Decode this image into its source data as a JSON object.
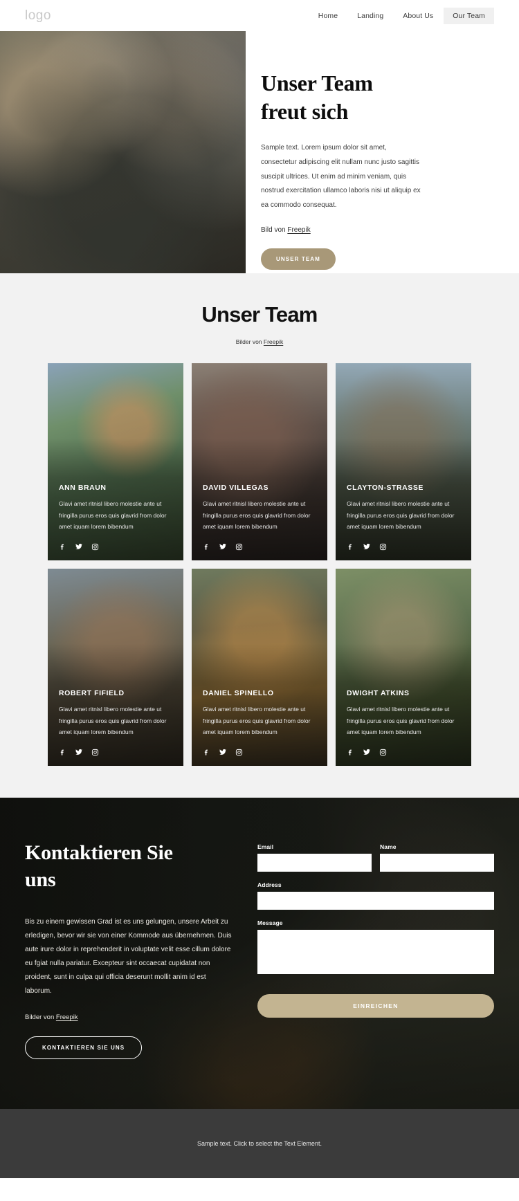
{
  "header": {
    "logo": "logo",
    "nav": [
      {
        "label": "Home",
        "active": false
      },
      {
        "label": "Landing",
        "active": false
      },
      {
        "label": "About Us",
        "active": false
      },
      {
        "label": "Our Team",
        "active": true
      }
    ]
  },
  "hero": {
    "title_line1": "Unser Team",
    "title_line2": "freut sich",
    "paragraph": "Sample text. Lorem ipsum dolor sit amet, consectetur adipiscing elit nullam nunc justo sagittis suscipit ultrices. Ut enim ad minim veniam, quis nostrud exercitation ullamco laboris nisi ut aliquip ex ea commodo consequat.",
    "credit_prefix": "Bild von ",
    "credit_link": "Freepik",
    "button_label": "UNSER TEAM",
    "button_color": "#a89878"
  },
  "team": {
    "title": "Unser Team",
    "credit_prefix": "Bilder von ",
    "credit_link": "Freepik",
    "shared_description": "Glavi amet ritnisl libero molestie ante ut fringilla purus eros quis glavrid from dolor amet iquam lorem bibendum",
    "social_icons": [
      "facebook-icon",
      "twitter-icon",
      "instagram-icon"
    ],
    "members": [
      {
        "name": "ANN BRAUN",
        "description": "Glavi amet ritnisl libero molestie ante ut fringilla purus eros quis glavrid from dolor amet iquam lorem bibendum"
      },
      {
        "name": "DAVID VILLEGAS",
        "description": "Glavi amet ritnisl libero molestie ante ut fringilla purus eros quis glavrid from dolor amet iquam lorem bibendum"
      },
      {
        "name": "CLAYTON-STRASSE",
        "description": "Glavi amet ritnisl libero molestie ante ut fringilla purus eros quis glavrid from dolor amet iquam lorem bibendum"
      },
      {
        "name": "ROBERT FIFIELD",
        "description": "Glavi amet ritnisl libero molestie ante ut fringilla purus eros quis glavrid from dolor amet iquam lorem bibendum"
      },
      {
        "name": "DANIEL SPINELLO",
        "description": "Glavi amet ritnisl libero molestie ante ut fringilla purus eros quis glavrid from dolor amet iquam lorem bibendum"
      },
      {
        "name": "DWIGHT ATKINS",
        "description": "Glavi amet ritnisl libero molestie ante ut fringilla purus eros quis glavrid from dolor amet iquam lorem bibendum"
      }
    ]
  },
  "contact": {
    "title_line1": "Kontaktieren Sie",
    "title_line2": "uns",
    "paragraph": "Bis zu einem gewissen Grad ist es uns gelungen, unsere Arbeit zu erledigen, bevor wir sie von einer Kommode aus übernehmen. Duis aute irure dolor in reprehenderit in voluptate velit esse cillum dolore eu fgiat nulla pariatur. Excepteur sint occaecat cupidatat non proident, sunt in culpa qui officia deserunt mollit anim id est laborum.",
    "credit_prefix": "Bilder von ",
    "credit_link": "Freepik",
    "button_label": "KONTAKTIEREN SIE UNS",
    "form": {
      "email_label": "Email",
      "email_value": "",
      "email_placeholder": "",
      "name_label": "Name",
      "name_value": "",
      "name_placeholder": "",
      "address_label": "Address",
      "address_value": "",
      "address_placeholder": "",
      "message_label": "Message",
      "message_value": "",
      "message_placeholder": "",
      "submit_label": "EINREICHEN",
      "submit_color": "#c3b491"
    }
  },
  "footer": {
    "text": "Sample text. Click to select the Text Element."
  }
}
